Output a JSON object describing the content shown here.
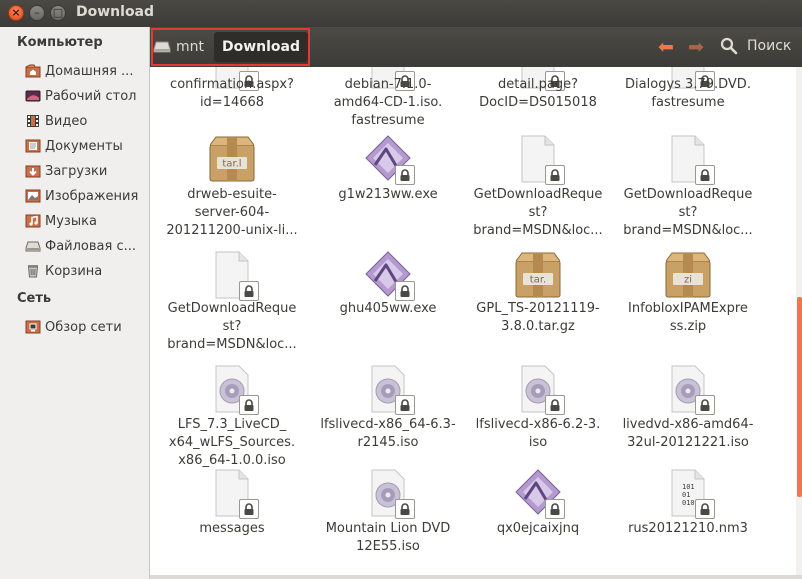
{
  "window": {
    "title": "Download"
  },
  "titlebar": {
    "close_glyph": "×",
    "min_glyph": "–",
    "max_glyph": "□"
  },
  "toolbar": {
    "path": [
      "mnt",
      "Download"
    ],
    "search_label": "Поиск",
    "back_glyph": "⬅",
    "forward_glyph": "➡",
    "accent": "#f07746"
  },
  "sidebar": {
    "computer_heading": "Компьютер",
    "computer_items": [
      {
        "label": "Домашняя ...",
        "icon": "home-folder-icon"
      },
      {
        "label": "Рабочий стол",
        "icon": "desktop-icon"
      },
      {
        "label": "Видео",
        "icon": "video-icon"
      },
      {
        "label": "Документы",
        "icon": "documents-icon"
      },
      {
        "label": "Загрузки",
        "icon": "downloads-icon"
      },
      {
        "label": "Изображения",
        "icon": "pictures-icon"
      },
      {
        "label": "Музыка",
        "icon": "music-icon"
      },
      {
        "label": "Файловая с...",
        "icon": "filesystem-icon"
      },
      {
        "label": "Корзина",
        "icon": "trash-icon"
      }
    ],
    "network_heading": "Сеть",
    "network_items": [
      {
        "label": "Обзор сети",
        "icon": "network-icon"
      }
    ]
  },
  "files": [
    {
      "lines": [
        "confirmation.aspx?",
        "id=14668"
      ],
      "icon": "document"
    },
    {
      "lines": [
        "debian-7.1.0-",
        "amd64-CD-1.iso.",
        "fastresume"
      ],
      "icon": "document"
    },
    {
      "lines": [
        "detail.page?",
        "DocID=DS015018"
      ],
      "icon": "document"
    },
    {
      "lines": [
        "Dialogys 3.79.DVD.",
        "fastresume"
      ],
      "icon": "document"
    },
    {
      "lines": [
        "drweb-esuite-",
        "server-604-",
        "201211200-unix-li..."
      ],
      "icon": "archive",
      "badge": "tar.l"
    },
    {
      "lines": [
        "g1w213ww.exe"
      ],
      "icon": "executable"
    },
    {
      "lines": [
        "GetDownloadReque",
        "st?",
        "brand=MSDN&loc..."
      ],
      "icon": "document"
    },
    {
      "lines": [
        "GetDownloadReque",
        "st?",
        "brand=MSDN&loc..."
      ],
      "icon": "document"
    },
    {
      "lines": [
        "GetDownloadReque",
        "st?",
        "brand=MSDN&loc..."
      ],
      "icon": "document"
    },
    {
      "lines": [
        "ghu405ww.exe"
      ],
      "icon": "executable"
    },
    {
      "lines": [
        "GPL_TS-20121119-",
        "3.8.0.tar.gz"
      ],
      "icon": "archive",
      "badge": "tar."
    },
    {
      "lines": [
        "InfobloxIPAMExpre",
        "ss.zip"
      ],
      "icon": "archive",
      "badge": "zi"
    },
    {
      "lines": [
        "LFS_7.3_LiveCD_",
        "x64_wLFS_Sources.",
        "x86_64-1.0.0.iso"
      ],
      "icon": "disc"
    },
    {
      "lines": [
        "lfslivecd-x86_64-6.3-",
        "r2145.iso"
      ],
      "icon": "disc"
    },
    {
      "lines": [
        "lfslivecd-x86-6.2-3.",
        "iso"
      ],
      "icon": "disc"
    },
    {
      "lines": [
        "livedvd-x86-amd64-",
        "32ul-20121221.iso"
      ],
      "icon": "disc"
    },
    {
      "lines": [
        "messages"
      ],
      "icon": "document"
    },
    {
      "lines": [
        "Mountain Lion DVD",
        "12E55.iso"
      ],
      "icon": "disc"
    },
    {
      "lines": [
        "qx0ejcaixjnq"
      ],
      "icon": "executable"
    },
    {
      "lines": [
        "rus20121210.nm3"
      ],
      "icon": "binary",
      "badge": "0101"
    }
  ]
}
